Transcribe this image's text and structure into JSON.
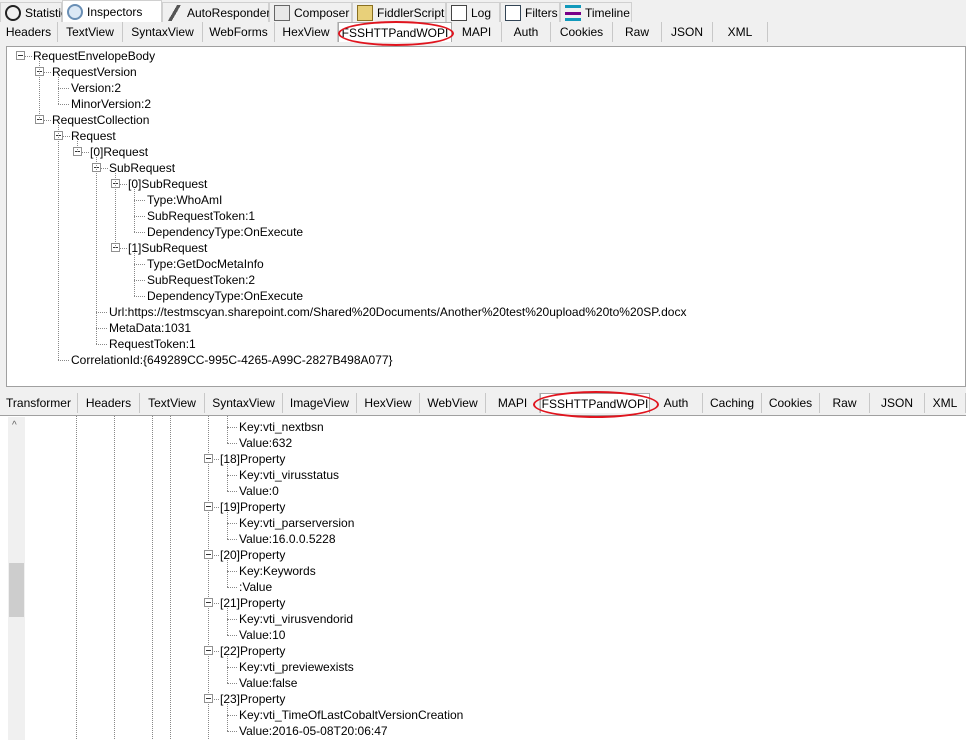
{
  "main_tabs": [
    {
      "label": "Statistics",
      "icon": "stopwatch-icon"
    },
    {
      "label": "Inspectors",
      "icon": "magnifier-icon",
      "selected": true
    },
    {
      "label": "AutoResponder",
      "icon": "lightning-icon"
    },
    {
      "label": "Composer",
      "icon": "pencil-icon"
    },
    {
      "label": "FiddlerScript",
      "icon": "script-icon"
    },
    {
      "label": "Log",
      "icon": "document-icon"
    },
    {
      "label": "Filters",
      "icon": "checkbox-icon"
    },
    {
      "label": "Timeline",
      "icon": "timeline-icon"
    }
  ],
  "request_tabs": [
    "Headers",
    "TextView",
    "SyntaxView",
    "WebForms",
    "HexView",
    "FSSHTTPandWOPI",
    "MAPI",
    "Auth",
    "Cookies",
    "Raw",
    "JSON",
    "XML"
  ],
  "request_selected": "FSSHTTPandWOPI",
  "response_tabs": [
    "Transformer",
    "Headers",
    "TextView",
    "SyntaxView",
    "ImageView",
    "HexView",
    "WebView",
    "MAPI",
    "FSSHTTPandWOPI",
    "Auth",
    "Caching",
    "Cookies",
    "Raw",
    "JSON",
    "XML"
  ],
  "response_selected": "FSSHTTPandWOPI",
  "highlight_color": "#e0141e",
  "request_tree": {
    "label": "RequestEnvelopeBody",
    "children": [
      {
        "label": "RequestVersion",
        "children": [
          {
            "label": "Version:2"
          },
          {
            "label": "MinorVersion:2"
          }
        ]
      },
      {
        "label": "RequestCollection",
        "children": [
          {
            "label": "Request",
            "children": [
              {
                "label": "[0]Request",
                "children": [
                  {
                    "label": "SubRequest",
                    "children": [
                      {
                        "label": "[0]SubRequest",
                        "children": [
                          {
                            "label": "Type:WhoAmI"
                          },
                          {
                            "label": "SubRequestToken:1"
                          },
                          {
                            "label": "DependencyType:OnExecute"
                          }
                        ]
                      },
                      {
                        "label": "[1]SubRequest",
                        "children": [
                          {
                            "label": "Type:GetDocMetaInfo"
                          },
                          {
                            "label": "SubRequestToken:2"
                          },
                          {
                            "label": "DependencyType:OnExecute"
                          }
                        ]
                      }
                    ]
                  },
                  {
                    "label": "Url:https://testmscyan.sharepoint.com/Shared%20Documents/Another%20test%20upload%20to%20SP.docx"
                  },
                  {
                    "label": "MetaData:1031"
                  },
                  {
                    "label": "RequestToken:1"
                  }
                ]
              }
            ]
          },
          {
            "label": "CorrelationId:{649289CC-995C-4265-A99C-2827B498A077}"
          }
        ]
      }
    ]
  },
  "response_tree": {
    "leading_leaves": [
      "Key:vti_nextbsn",
      "Value:632"
    ],
    "properties": [
      {
        "label": "[18]Property",
        "children": [
          "Key:vti_virusstatus",
          "Value:0"
        ]
      },
      {
        "label": "[19]Property",
        "children": [
          "Key:vti_parserversion",
          "Value:16.0.0.5228"
        ]
      },
      {
        "label": "[20]Property",
        "children": [
          "Key:Keywords",
          ":Value"
        ]
      },
      {
        "label": "[21]Property",
        "children": [
          "Key:vti_virusvendorid",
          "Value:10"
        ]
      },
      {
        "label": "[22]Property",
        "children": [
          "Key:vti_previewexists",
          "Value:false"
        ]
      },
      {
        "label": "[23]Property",
        "children": [
          "Key:vti_TimeOfLastCobaltVersionCreation",
          "Value:2016-05-08T20:06:47"
        ]
      }
    ]
  }
}
